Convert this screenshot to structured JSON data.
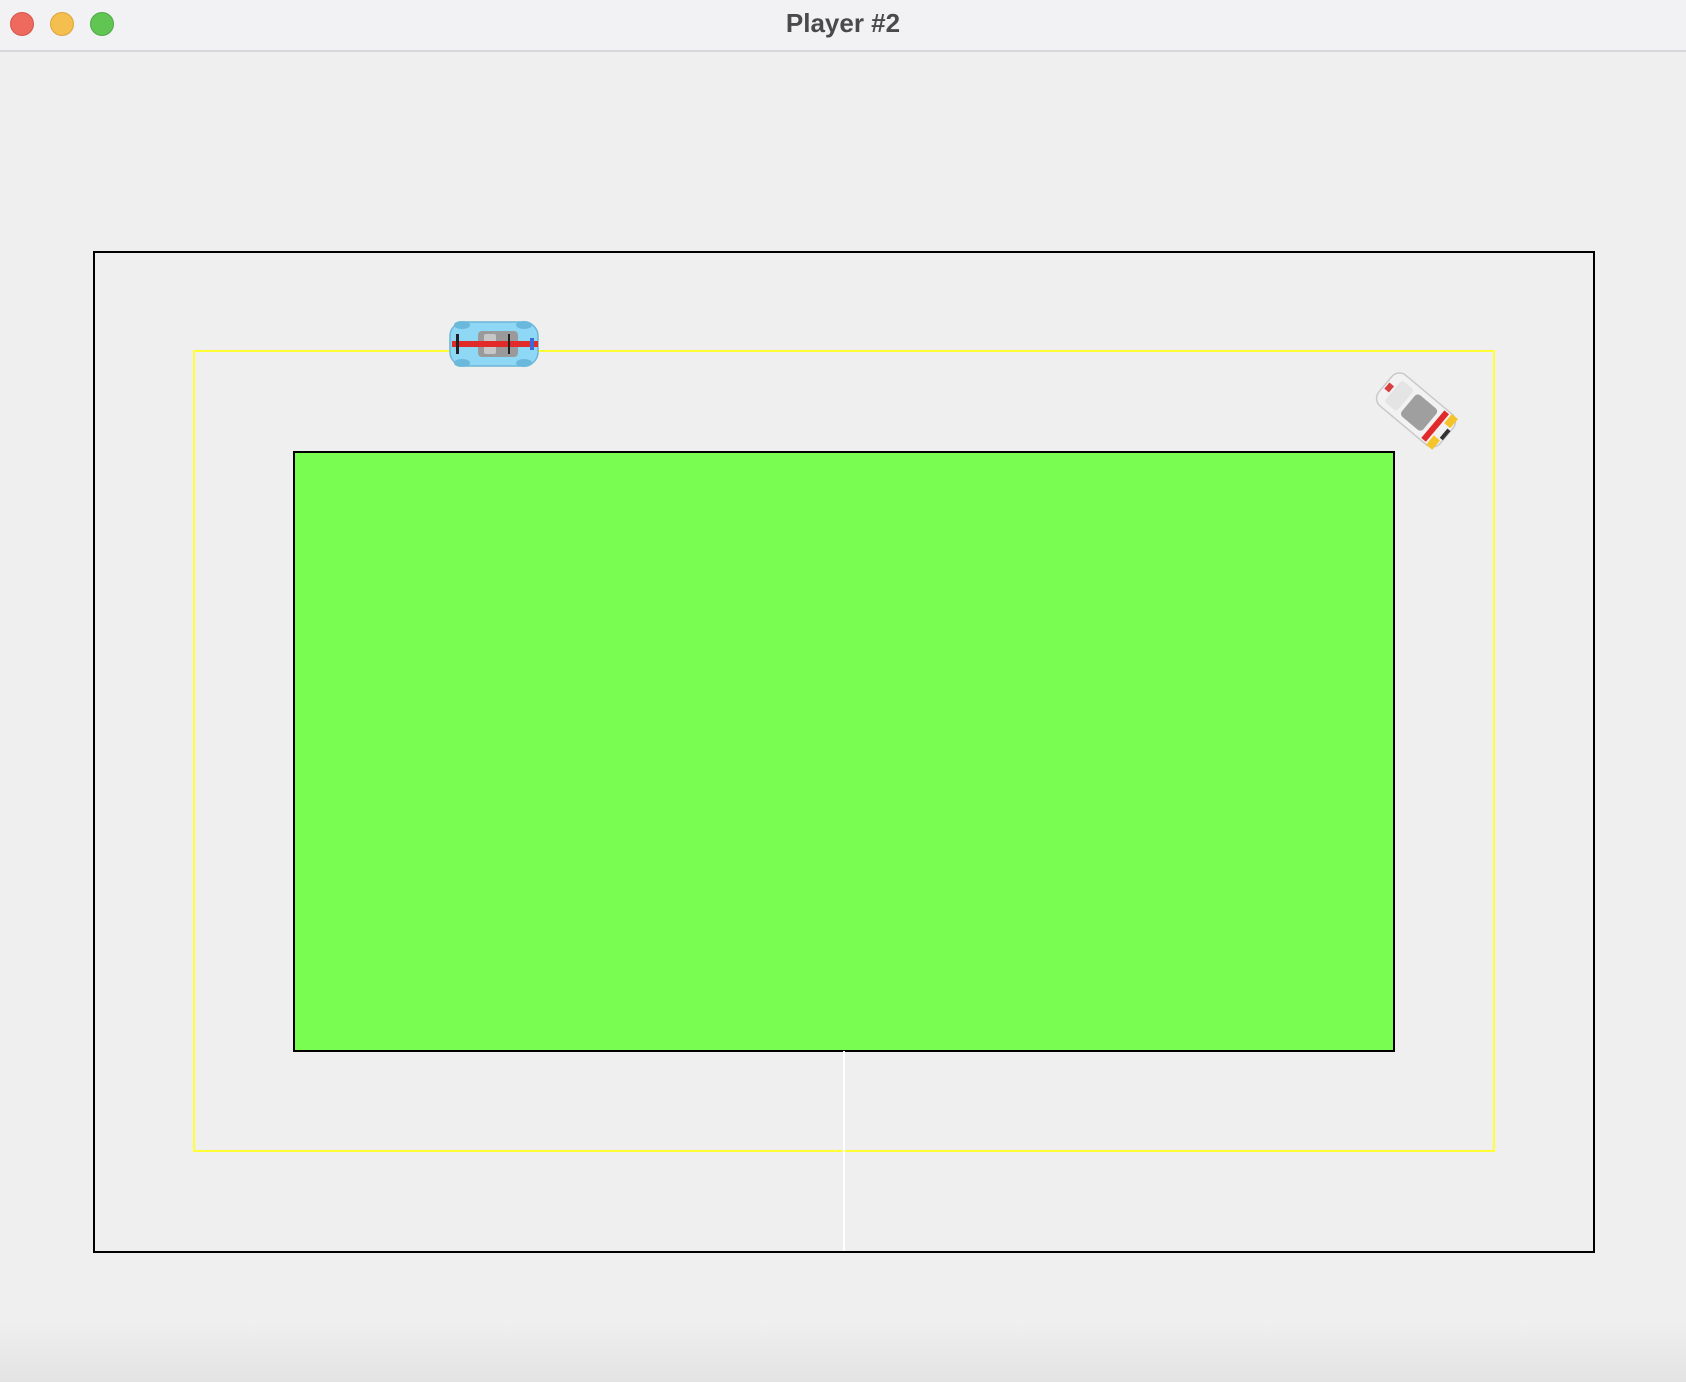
{
  "window": {
    "title": "Player #2",
    "controls": [
      "close-icon",
      "minimize-icon",
      "maximize-icon"
    ]
  },
  "game": {
    "colors": {
      "background": "#efefef",
      "infield": "#79fd50",
      "track_border": "#000000",
      "racing_line": "#ffff33",
      "finish_line": "#ffffff"
    },
    "cars": [
      {
        "name": "blue-race-car",
        "color": "#8fd8f5",
        "stripe": "#e12a2a",
        "heading": "east"
      },
      {
        "name": "white-race-car",
        "color": "#f2f2f2",
        "stripe": "#e12a2a",
        "heading": "south-east"
      }
    ]
  }
}
